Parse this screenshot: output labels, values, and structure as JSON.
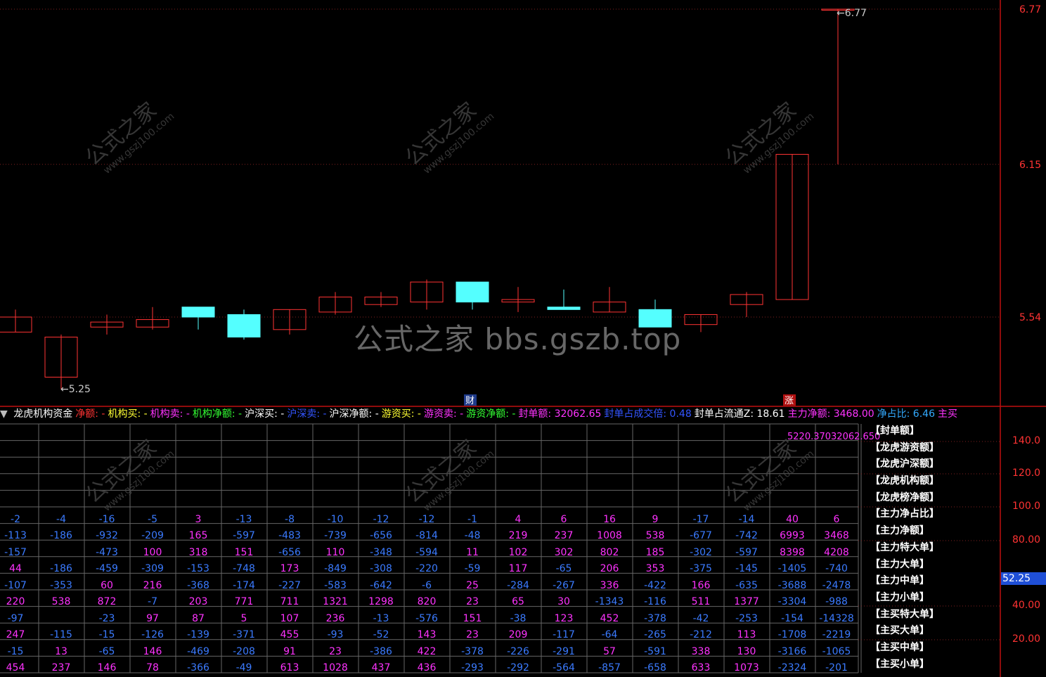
{
  "main_chart": {
    "price_labels": [
      "6.77",
      "6.15",
      "5.54"
    ],
    "low_marker": "5.25",
    "high_marker": "6.77",
    "marker_cai": "财",
    "marker_zhang": "涨",
    "candles": [
      {
        "o": 5.48,
        "c": 5.54,
        "h": 5.57,
        "l": 5.48
      },
      {
        "o": 5.3,
        "c": 5.46,
        "h": 5.47,
        "l": 5.25
      },
      {
        "o": 5.5,
        "c": 5.52,
        "h": 5.55,
        "l": 5.47
      },
      {
        "o": 5.5,
        "c": 5.53,
        "h": 5.58,
        "l": 5.49
      },
      {
        "o": 5.58,
        "c": 5.54,
        "h": 5.58,
        "l": 5.49
      },
      {
        "o": 5.55,
        "c": 5.46,
        "h": 5.57,
        "l": 5.45
      },
      {
        "o": 5.49,
        "c": 5.57,
        "h": 5.57,
        "l": 5.47
      },
      {
        "o": 5.56,
        "c": 5.62,
        "h": 5.64,
        "l": 5.55
      },
      {
        "o": 5.59,
        "c": 5.62,
        "h": 5.64,
        "l": 5.58
      },
      {
        "o": 5.6,
        "c": 5.68,
        "h": 5.69,
        "l": 5.57
      },
      {
        "o": 5.68,
        "c": 5.6,
        "h": 5.68,
        "l": 5.57
      },
      {
        "o": 5.6,
        "c": 5.61,
        "h": 5.66,
        "l": 5.56
      },
      {
        "o": 5.58,
        "c": 5.57,
        "h": 5.65,
        "l": 5.57
      },
      {
        "o": 5.56,
        "c": 5.6,
        "h": 5.66,
        "l": 5.56
      },
      {
        "o": 5.57,
        "c": 5.5,
        "h": 5.61,
        "l": 5.5
      },
      {
        "o": 5.51,
        "c": 5.55,
        "h": 5.55,
        "l": 5.48
      },
      {
        "o": 5.59,
        "c": 5.63,
        "h": 5.64,
        "l": 5.54
      },
      {
        "o": 5.61,
        "c": 6.19,
        "h": 6.19,
        "l": 5.61
      },
      {
        "o": 6.77,
        "c": 6.77,
        "h": 6.77,
        "l": 6.15
      }
    ]
  },
  "watermark": {
    "center": "公式之家 bbs.gszb.top",
    "diag": "公式之家",
    "diag_url": "www.gszj100.com"
  },
  "indicator": {
    "header": [
      {
        "text": "龙虎机构资金",
        "color": "#ffffff"
      },
      {
        "text": "净额: -",
        "color": "#ff3333"
      },
      {
        "text": "机构买: -",
        "color": "#ffff33"
      },
      {
        "text": "机构卖: -",
        "color": "#ff33ff"
      },
      {
        "text": "机构净额: -",
        "color": "#33ff33"
      },
      {
        "text": "沪深买: -",
        "color": "#ffffff"
      },
      {
        "text": "沪深卖: -",
        "color": "#3355ff"
      },
      {
        "text": "沪深净额: -",
        "color": "#ffffff"
      },
      {
        "text": "游资买: -",
        "color": "#ffff33"
      },
      {
        "text": "游资卖: -",
        "color": "#ff33ff"
      },
      {
        "text": "游资净额: -",
        "color": "#33ff33"
      },
      {
        "text": "封单额: 32062.65",
        "color": "#ff33ff"
      },
      {
        "text": "封单占成交倍: 0.48",
        "color": "#3355ff"
      },
      {
        "text": "封单占流通Z: 18.61",
        "color": "#ffffff"
      },
      {
        "text": "主力净额: 3468.00",
        "color": "#ff33ff"
      },
      {
        "text": "净占比: 6.46",
        "color": "#33aaff"
      },
      {
        "text": "主买",
        "color": "#ff33ff"
      }
    ],
    "top_value": "5220.37032062.650",
    "legend": [
      "【封单额】",
      "【龙虎游资额】",
      "【龙虎沪深额】",
      "【龙虎机构额】",
      "【龙虎榜净额】",
      "【主力净占比】",
      "【主力净额】",
      "【主力特大单】",
      "【主力大单】",
      "【主力中单】",
      "【主力小单】",
      "【主买特大单】",
      "【主买大单】",
      "【主买中单】",
      "【主买小单】"
    ],
    "right_axis": [
      "140.0",
      "120.0",
      "100.0",
      "80.00",
      "40.00",
      "20.00"
    ],
    "current_value": "52.25",
    "rows": [
      [
        "-2",
        "-4",
        "-16",
        "-5",
        "3",
        "-13",
        "-8",
        "-10",
        "-12",
        "-12",
        "-1",
        "4",
        "6",
        "16",
        "9",
        "-17",
        "-14",
        "40",
        "6"
      ],
      [
        "-113",
        "-186",
        "-932",
        "-209",
        "165",
        "-597",
        "-483",
        "-739",
        "-656",
        "-814",
        "-48",
        "219",
        "237",
        "1008",
        "538",
        "-677",
        "-742",
        "6993",
        "3468"
      ],
      [
        "-157",
        "",
        "-473",
        "100",
        "318",
        "151",
        "-656",
        "110",
        "-348",
        "-594",
        "11",
        "102",
        "302",
        "802",
        "185",
        "-302",
        "-597",
        "8398",
        "4208"
      ],
      [
        "44",
        "-186",
        "-459",
        "-309",
        "-153",
        "-748",
        "173",
        "-849",
        "-308",
        "-220",
        "-59",
        "117",
        "-65",
        "206",
        "353",
        "-375",
        "-145",
        "-1405",
        "-740"
      ],
      [
        "-107",
        "-353",
        "60",
        "216",
        "-368",
        "-174",
        "-227",
        "-583",
        "-642",
        "-6",
        "25",
        "-284",
        "-267",
        "336",
        "-422",
        "166",
        "-635",
        "-3688",
        "-2478"
      ],
      [
        "220",
        "538",
        "872",
        "-7",
        "203",
        "771",
        "711",
        "1321",
        "1298",
        "820",
        "23",
        "65",
        "30",
        "-1343",
        "-116",
        "511",
        "1377",
        "-3304",
        "-988"
      ],
      [
        "-97",
        "",
        "-23",
        "97",
        "87",
        "5",
        "107",
        "236",
        "-13",
        "-576",
        "151",
        "-38",
        "123",
        "452",
        "-378",
        "-42",
        "-253",
        "-154",
        "-14328"
      ],
      [
        "247",
        "-115",
        "-15",
        "-126",
        "-139",
        "-371",
        "455",
        "-93",
        "-52",
        "143",
        "23",
        "209",
        "-117",
        "-64",
        "-265",
        "-212",
        "113",
        "-1708",
        "-2219"
      ],
      [
        "-15",
        "13",
        "-65",
        "146",
        "-469",
        "-208",
        "91",
        "23",
        "-386",
        "422",
        "-378",
        "-226",
        "-291",
        "57",
        "-591",
        "338",
        "130",
        "-3166",
        "-1065"
      ],
      [
        "454",
        "237",
        "146",
        "78",
        "-366",
        "-49",
        "613",
        "1028",
        "437",
        "436",
        "-293",
        "-292",
        "-564",
        "-857",
        "-658",
        "633",
        "1073",
        "-2324",
        "-201"
      ]
    ],
    "colors": {
      "neg": "#3b7bff",
      "pos": "#ff33ff",
      "grid": "#666666",
      "axis": "#ff3333"
    }
  }
}
